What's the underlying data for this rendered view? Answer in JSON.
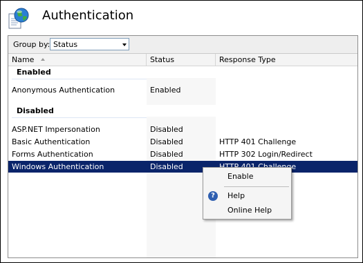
{
  "header": {
    "title": "Authentication",
    "icon": "globe-document-icon"
  },
  "group_bar": {
    "label": "Group by:",
    "selected": "Status"
  },
  "columns": {
    "name": "Name",
    "status": "Status",
    "response_type": "Response Type"
  },
  "groups": {
    "enabled": {
      "title": "Enabled",
      "rows": [
        {
          "name": "Anonymous Authentication",
          "status": "Enabled",
          "response_type": ""
        }
      ]
    },
    "disabled": {
      "title": "Disabled",
      "rows": [
        {
          "name": "ASP.NET Impersonation",
          "status": "Disabled",
          "response_type": ""
        },
        {
          "name": "Basic Authentication",
          "status": "Disabled",
          "response_type": "HTTP 401 Challenge"
        },
        {
          "name": "Forms Authentication",
          "status": "Disabled",
          "response_type": "HTTP 302 Login/Redirect"
        },
        {
          "name": "Windows Authentication",
          "status": "Disabled",
          "response_type": "HTTP 401 Challenge"
        }
      ]
    }
  },
  "context_menu": {
    "items": [
      {
        "label": "Enable"
      },
      {
        "label": "Help",
        "icon": "help-icon"
      },
      {
        "label": "Online Help"
      }
    ]
  },
  "colors": {
    "selection": "#0a246a",
    "help_icon": "#2f5fb0"
  }
}
